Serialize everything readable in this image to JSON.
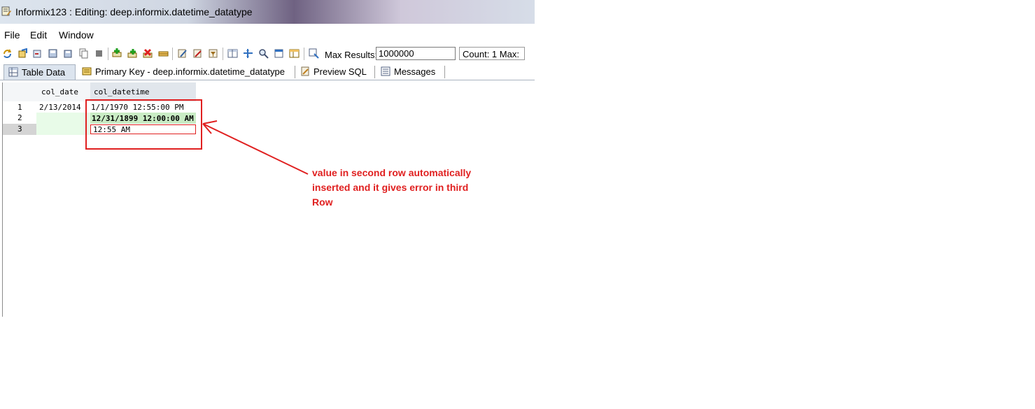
{
  "window": {
    "title": "Informix123 : Editing: deep.informix.datetime_datatype"
  },
  "menu": [
    "File",
    "Edit",
    "Window"
  ],
  "toolbar": {
    "max_results_label": "Max Results:",
    "max_results_value": "1000000",
    "count_text": "Count: 1  Max:"
  },
  "tabs": [
    {
      "label": "Table Data",
      "icon": "table-icon",
      "active": true
    },
    {
      "label": "Primary Key - deep.informix.datetime_datatype",
      "icon": "key-icon",
      "active": false
    },
    {
      "label": "Preview SQL",
      "icon": "sql-icon",
      "active": false
    },
    {
      "label": "Messages",
      "icon": "messages-icon",
      "active": false
    }
  ],
  "grid": {
    "columns": [
      "col_date",
      "col_datetime"
    ],
    "rows": [
      {
        "num": "1",
        "col_date": "2/13/2014",
        "col_datetime": "1/1/1970 12:55:00 PM"
      },
      {
        "num": "2",
        "col_date": "",
        "col_datetime": "12/31/1899 12:00:00 AM"
      },
      {
        "num": "3",
        "col_date": "",
        "col_datetime": "12:55 AM"
      }
    ]
  },
  "annotation": {
    "text": "value in second row automatically inserted and it gives error in third Row"
  },
  "colors": {
    "annotation": "#e02020",
    "new_row": "#e8fbe8",
    "selected_cell": "#c9ecc4"
  }
}
